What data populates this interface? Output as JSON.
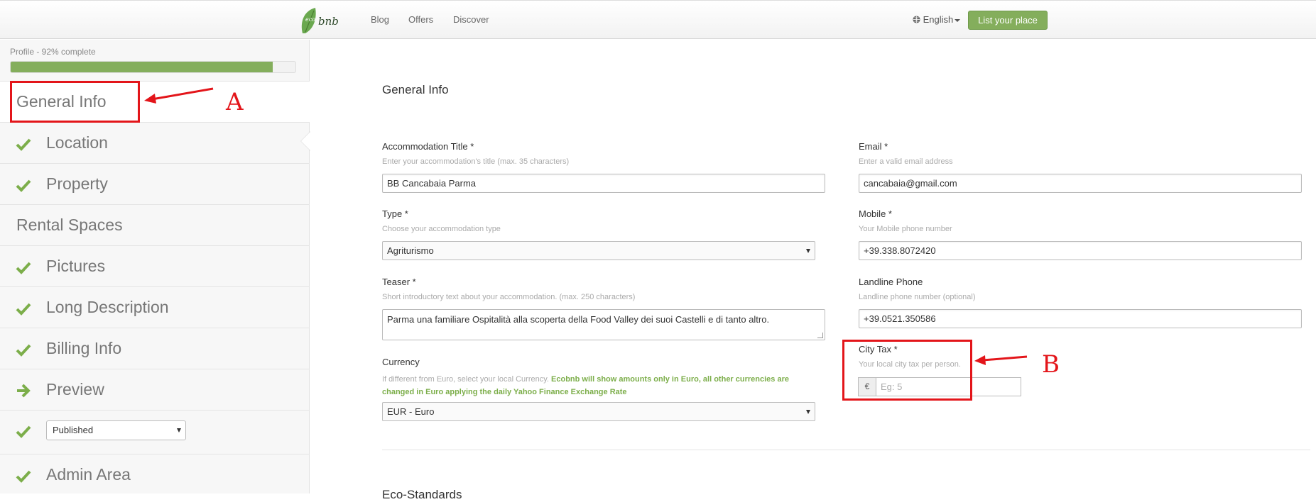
{
  "topbar": {
    "logo_text": "bnb",
    "logo_sub": "eco",
    "nav": [
      "Blog",
      "Offers",
      "Discover"
    ],
    "language": "English",
    "list_button": "List your place",
    "brand_color": "#84ae5c"
  },
  "sidebar": {
    "progress_label": "Profile - 92% complete",
    "progress_percent": 92,
    "items": [
      {
        "label": "General Info",
        "icon": "none"
      },
      {
        "label": "Location",
        "icon": "check-icon"
      },
      {
        "label": "Property",
        "icon": "check-icon"
      },
      {
        "label": "Rental Spaces",
        "icon": "none"
      },
      {
        "label": "Pictures",
        "icon": "check-icon"
      },
      {
        "label": "Long Description",
        "icon": "check-icon"
      },
      {
        "label": "Billing Info",
        "icon": "check-icon"
      },
      {
        "label": "Preview",
        "icon": "arrow-right-icon"
      },
      {
        "label": "Published",
        "icon": "check-icon"
      },
      {
        "label": "Admin Area",
        "icon": "check-icon"
      }
    ]
  },
  "main": {
    "title": "General Info",
    "accommodation_title": {
      "label": "Accommodation Title *",
      "hint": "Enter your accommodation's title (max. 35 characters)",
      "value": "BB Cancabaia Parma"
    },
    "email": {
      "label": "Email *",
      "hint": "Enter a valid email address",
      "value": "cancabaia@gmail.com"
    },
    "type": {
      "label": "Type *",
      "hint": "Choose your accommodation type",
      "value": "Agriturismo"
    },
    "mobile": {
      "label": "Mobile *",
      "hint": "Your Mobile phone number",
      "value": "+39.338.8072420"
    },
    "teaser": {
      "label": "Teaser *",
      "hint": "Short introductory text about your accommodation. (max. 250 characters)",
      "value": "Parma una familiare Ospitalità alla scoperta della Food Valley dei suoi Castelli e di tanto altro."
    },
    "landline": {
      "label": "Landline Phone",
      "hint": "Landline phone number (optional)",
      "value": "+39.0521.350586"
    },
    "currency": {
      "label": "Currency",
      "hint": "If different from Euro, select your local Currency.",
      "hint_green": "Ecobnb will show amounts only in Euro, all other currencies are changed in Euro applying the daily Yahoo Finance Exchange Rate",
      "value": "EUR - Euro"
    },
    "city_tax": {
      "label": "City Tax *",
      "hint": "Your local city tax per person.",
      "symbol": "€",
      "placeholder": "Eg: 5"
    },
    "next_section": "Eco-Standards"
  },
  "annotations": {
    "a": "A",
    "b": "B",
    "color": "#e3151a"
  }
}
